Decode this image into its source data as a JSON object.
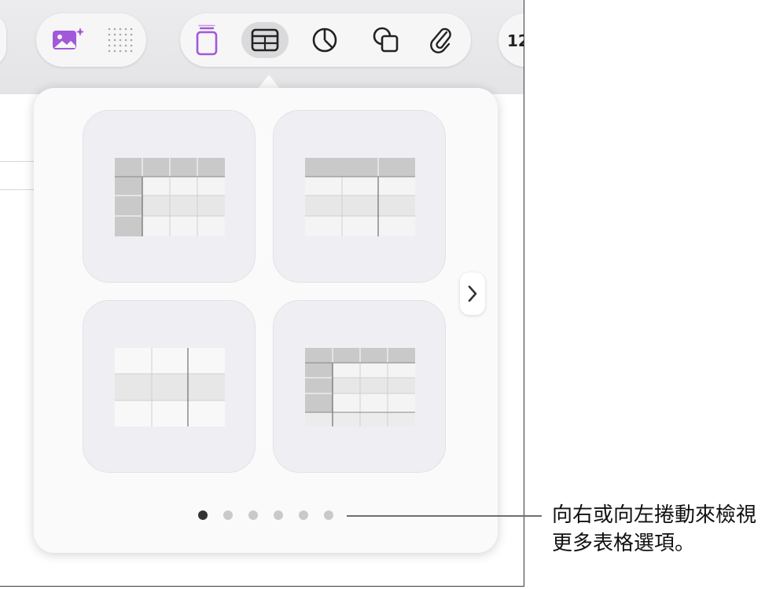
{
  "toolbar": {
    "number_label": "12",
    "buttons": [
      {
        "id": "media-icon"
      },
      {
        "id": "dot-grid-icon"
      },
      {
        "id": "text-box-icon"
      },
      {
        "id": "table-icon",
        "active": true
      },
      {
        "id": "chart-icon"
      },
      {
        "id": "shape-icon"
      },
      {
        "id": "attachment-icon"
      }
    ],
    "accent_color": "#a259d9"
  },
  "popover": {
    "title": "",
    "page_count": 6,
    "current_page": 1
  },
  "callout": {
    "line1": "向右或向左捲動來檢視",
    "line2": "更多表格選項。"
  }
}
